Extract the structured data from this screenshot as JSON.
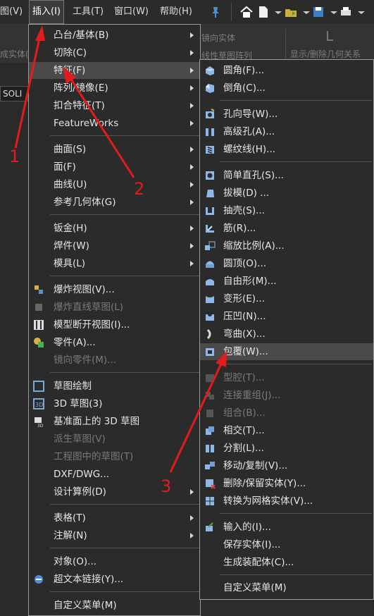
{
  "menubar": {
    "items": [
      "图(V)",
      "插入(I)",
      "工具(T)",
      "窗口(W)",
      "帮助(H)"
    ]
  },
  "toolbar": {
    "labels": [
      "成实体(",
      "镜向实体",
      "线性草图阵列",
      "显示/删除几何关系"
    ],
    "solid_tab": "SOLI"
  },
  "insert_menu": {
    "items": [
      {
        "label": "凸台/基体(B)",
        "submenu": true
      },
      {
        "label": "切除(C)",
        "submenu": true
      },
      {
        "label": "特征(F)",
        "submenu": true,
        "highlighted": true
      },
      {
        "label": "阵列/镜像(E)",
        "submenu": true
      },
      {
        "label": "扣合特征(T)",
        "submenu": true
      },
      {
        "label": "FeatureWorks",
        "submenu": true
      },
      {
        "label": "曲面(S)",
        "submenu": true
      },
      {
        "label": "面(F)",
        "submenu": true
      },
      {
        "label": "曲线(U)",
        "submenu": true
      },
      {
        "label": "参考几何体(G)",
        "submenu": true
      },
      {
        "label": "钣金(H)",
        "submenu": true
      },
      {
        "label": "焊件(W)",
        "submenu": true
      },
      {
        "label": "模具(L)",
        "submenu": true
      },
      {
        "label": "爆炸视图(V)...",
        "icon": "explode-view-icon"
      },
      {
        "label": "爆炸直线草图(L)",
        "icon": "explode-line-icon",
        "disabled": true
      },
      {
        "label": "模型断开视图(I)...",
        "icon": "break-view-icon"
      },
      {
        "label": "零件(A)...",
        "icon": "part-icon"
      },
      {
        "label": "镜向零件(M)...",
        "disabled": true
      },
      {
        "label": "草图绘制",
        "icon": "sketch-icon"
      },
      {
        "label": "3D 草图(3)",
        "icon": "3d-sketch-icon"
      },
      {
        "label": "基准面上的 3D 草图",
        "icon": "3d-sketch-plane-icon"
      },
      {
        "label": "派生草图(V)",
        "disabled": true
      },
      {
        "label": "工程图中的草图(T)",
        "disabled": true
      },
      {
        "label": "DXF/DWG..."
      },
      {
        "label": "设计算例(D)",
        "submenu": true
      },
      {
        "label": "表格(T)",
        "submenu": true
      },
      {
        "label": "注解(N)",
        "submenu": true
      },
      {
        "label": "对象(O)..."
      },
      {
        "label": "超文本链接(Y)...",
        "icon": "hyperlink-icon"
      },
      {
        "label": "自定义菜单(M)"
      }
    ]
  },
  "feature_menu": {
    "items": [
      {
        "label": "圆角(F)...",
        "icon": "fillet-icon"
      },
      {
        "label": "倒角(C)...",
        "icon": "chamfer-icon"
      },
      {
        "label": "孔向导(W)...",
        "icon": "hole-wizard-icon"
      },
      {
        "label": "高级孔(A)...",
        "icon": "advanced-hole-icon"
      },
      {
        "label": "螺纹线(H)...",
        "icon": "thread-icon"
      },
      {
        "label": "简单直孔(S)...",
        "icon": "simple-hole-icon"
      },
      {
        "label": "拔模(D) ...",
        "icon": "draft-icon"
      },
      {
        "label": "抽壳(S)...",
        "icon": "shell-icon"
      },
      {
        "label": "筋(R)...",
        "icon": "rib-icon"
      },
      {
        "label": "缩放比例(A)...",
        "icon": "scale-icon"
      },
      {
        "label": "圆顶(O)...",
        "icon": "dome-icon"
      },
      {
        "label": "自由形(M)...",
        "icon": "freeform-icon"
      },
      {
        "label": "变形(E)...",
        "icon": "deform-icon"
      },
      {
        "label": "压凹(N)...",
        "icon": "indent-icon"
      },
      {
        "label": "弯曲(X)...",
        "icon": "flex-icon"
      },
      {
        "label": "包覆(W)...",
        "icon": "wrap-icon",
        "highlighted": true
      },
      {
        "label": "型腔(T)...",
        "icon": "cavity-icon",
        "disabled": true
      },
      {
        "label": "连接重组(J)...",
        "icon": "join-icon",
        "disabled": true
      },
      {
        "label": "组合(B)...",
        "icon": "combine-icon",
        "disabled": true
      },
      {
        "label": "相交(T)...",
        "icon": "intersect-icon"
      },
      {
        "label": "分割(L)...",
        "icon": "split-icon"
      },
      {
        "label": "移动/复制(V)...",
        "icon": "move-copy-icon"
      },
      {
        "label": "删除/保留实体(Y)...",
        "icon": "delete-body-icon"
      },
      {
        "label": "转换为网格实体(V)...",
        "icon": "mesh-icon"
      },
      {
        "label": "输入的(I)...",
        "icon": "imported-icon"
      },
      {
        "label": "保存实体(I)..."
      },
      {
        "label": "生成装配体(C)..."
      },
      {
        "label": "自定义菜单(M)"
      }
    ]
  },
  "annotations": [
    "1",
    "2",
    "3"
  ],
  "colors": {
    "annotation": "#e21c1c",
    "menu_bg": "#2b2b2b",
    "highlight": "#4a4a4a"
  }
}
